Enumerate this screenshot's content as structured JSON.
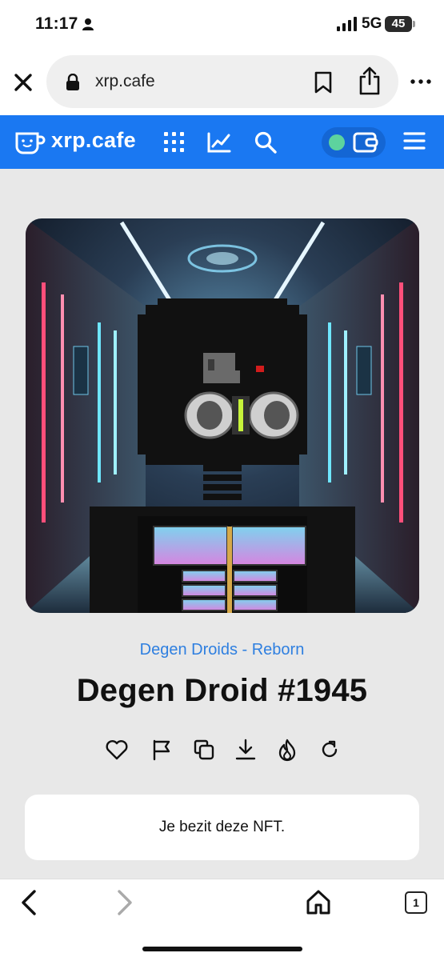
{
  "status_bar": {
    "time": "11:17",
    "network": "5G",
    "battery": "45"
  },
  "browser": {
    "url": "xrp.cafe",
    "close_icon": "close-icon",
    "lock_icon": "lock-icon",
    "bookmark_icon": "bookmark-icon",
    "share_icon": "share-icon",
    "more_icon": "more-icon"
  },
  "site_nav": {
    "logo_text": "xrp.cafe",
    "brand_color": "#1a78f2",
    "connected_color": "#5dd39e",
    "icons": [
      "grid-icon",
      "chart-icon",
      "search-icon",
      "wallet-icon",
      "menu-icon"
    ]
  },
  "nft": {
    "collection": "Degen Droids - Reborn",
    "title": "Degen Droid #1945",
    "owned_text": "Je bezit deze NFT.",
    "actions": [
      "heart-icon",
      "flag-icon",
      "copy-icon",
      "download-icon",
      "burn-icon",
      "refresh-icon"
    ]
  },
  "toolbar": {
    "tab_count": "1",
    "icons": [
      "back-icon",
      "forward-icon",
      "home-icon",
      "tabs-icon"
    ]
  }
}
